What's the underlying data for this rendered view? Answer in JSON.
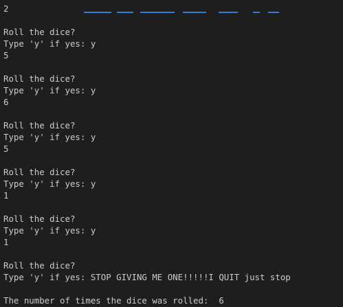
{
  "terminal": {
    "first_output": "2",
    "rounds": [
      {
        "prompt": "Roll the dice?",
        "input_label": "Type 'y' if yes: ",
        "input_value": "y",
        "result": "5"
      },
      {
        "prompt": "Roll the dice?",
        "input_label": "Type 'y' if yes: ",
        "input_value": "y",
        "result": "6"
      },
      {
        "prompt": "Roll the dice?",
        "input_label": "Type 'y' if yes: ",
        "input_value": "y",
        "result": "5"
      },
      {
        "prompt": "Roll the dice?",
        "input_label": "Type 'y' if yes: ",
        "input_value": "y",
        "result": "1"
      },
      {
        "prompt": "Roll the dice?",
        "input_label": "Type 'y' if yes: ",
        "input_value": "y",
        "result": "1"
      }
    ],
    "final_round": {
      "prompt": "Roll the dice?",
      "input_label": "Type 'y' if yes: ",
      "input_value": "STOP GIVING ME ONE!!!!!I QUIT just stop"
    },
    "summary_label": "The number of times the dice was rolled:  ",
    "summary_value": "6"
  },
  "colors": {
    "background": "#1e1e1e",
    "text": "#cccccc",
    "link_clipped": "#3794ff"
  }
}
